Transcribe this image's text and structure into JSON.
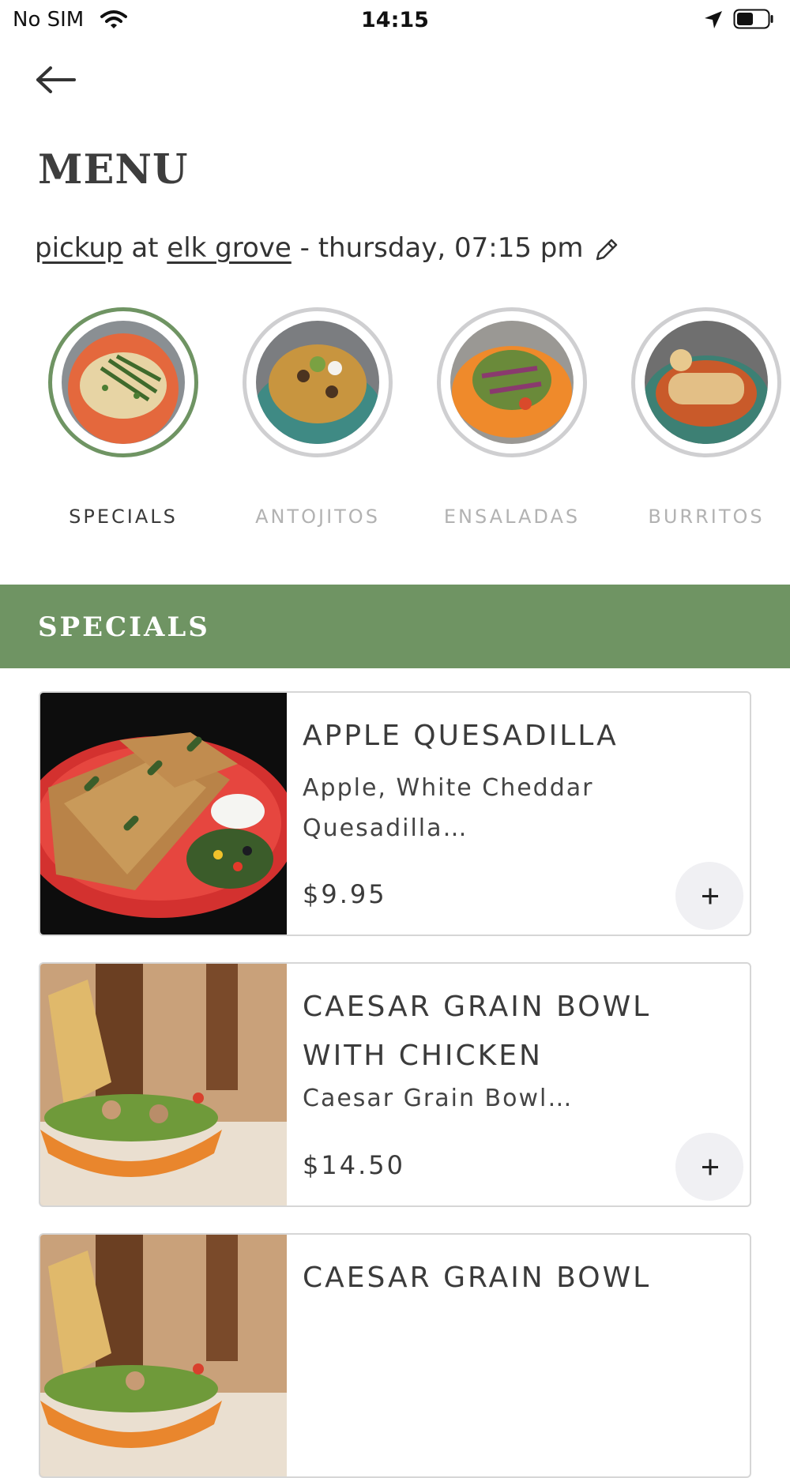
{
  "status_bar": {
    "carrier": "No SIM",
    "time": "14:15",
    "battery_level": 0.55
  },
  "page": {
    "title": "MENU"
  },
  "order_info": {
    "mode": "pickup",
    "at": "at",
    "location": "elk grove",
    "schedule": "- thursday, 07:15 pm"
  },
  "categories": [
    {
      "label": "SPECIALS",
      "active": true
    },
    {
      "label": "ANTOJITOS",
      "active": false
    },
    {
      "label": "ENSALADAS",
      "active": false
    },
    {
      "label": "BURRITOS",
      "active": false
    }
  ],
  "section": {
    "title": "SPECIALS"
  },
  "items": [
    {
      "name": "APPLE QUESADILLA",
      "description": "Apple, White Cheddar Quesadilla…",
      "price": "$9.95"
    },
    {
      "name": "CAESAR GRAIN BOWL WITH CHICKEN",
      "description": "Caesar Grain Bowl…",
      "price": "$14.50"
    },
    {
      "name": "CAESAR GRAIN BOWL",
      "description": "",
      "price": ""
    }
  ],
  "colors": {
    "accent": "#6f9463",
    "inactive_label": "#b2b2b2",
    "ring_inactive": "#cfcfd1"
  },
  "icons": {
    "back": "arrow-left-icon",
    "edit": "pencil-icon",
    "add": "plus-icon"
  }
}
